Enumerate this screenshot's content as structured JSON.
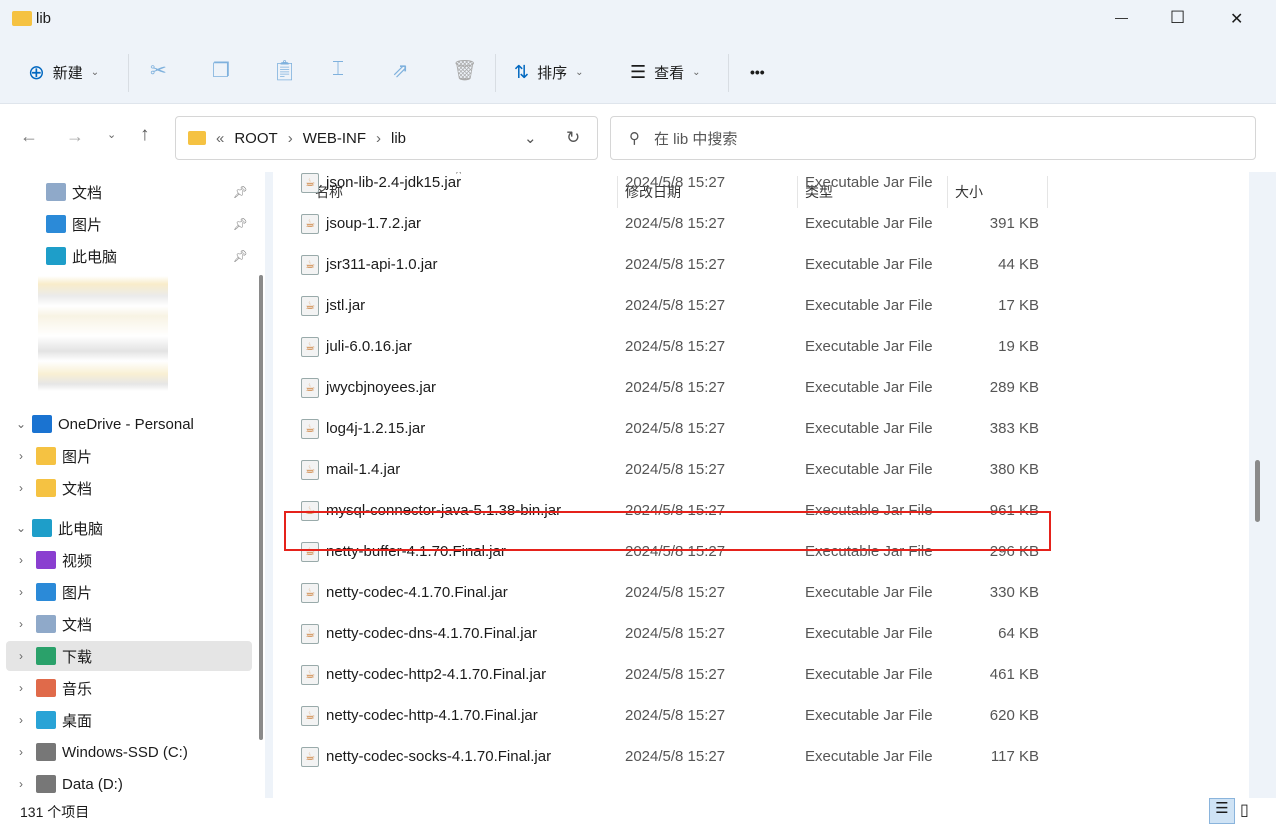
{
  "window": {
    "title": "lib",
    "minimize": "—",
    "maximize": "☐",
    "close": "✕"
  },
  "toolbar": {
    "new_label": "新建",
    "sort_label": "排序",
    "view_label": "查看",
    "more": "•••"
  },
  "address": {
    "crumbs": [
      "«",
      "ROOT",
      "›",
      "WEB-INF",
      "›",
      "lib"
    ],
    "search_placeholder": "在 lib 中搜索"
  },
  "nav": {
    "items": [
      {
        "label": "文档",
        "icon": "documents-icon",
        "pinned": true
      },
      {
        "label": "图片",
        "icon": "pictures-icon",
        "pinned": true
      },
      {
        "label": "此电脑",
        "icon": "computer-icon",
        "pinned": true
      },
      {
        "label": "OneDrive - Personal",
        "icon": "onedrive-icon",
        "expanded": true
      },
      {
        "label": "图片",
        "icon": "folder-icon"
      },
      {
        "label": "文档",
        "icon": "folder-icon"
      },
      {
        "label": "此电脑",
        "icon": "computer-icon",
        "expanded": true
      },
      {
        "label": "视频",
        "icon": "videos-icon"
      },
      {
        "label": "图片",
        "icon": "pictures-icon"
      },
      {
        "label": "文档",
        "icon": "documents-icon"
      },
      {
        "label": "下载",
        "icon": "downloads-icon",
        "selected": true
      },
      {
        "label": "音乐",
        "icon": "music-icon"
      },
      {
        "label": "桌面",
        "icon": "desktop-icon"
      },
      {
        "label": "Windows-SSD (C:)",
        "icon": "drive-icon"
      },
      {
        "label": "Data (D:)",
        "icon": "drive-icon"
      }
    ]
  },
  "columns": {
    "name": "名称",
    "modified": "修改日期",
    "type": "类型",
    "size": "大小"
  },
  "files": [
    {
      "name": "json-lib-2.4-jdk15.jar",
      "date": "2024/5/8 15:27",
      "type": "Executable Jar File",
      "size": ""
    },
    {
      "name": "jsoup-1.7.2.jar",
      "date": "2024/5/8 15:27",
      "type": "Executable Jar File",
      "size": "391 KB"
    },
    {
      "name": "jsr311-api-1.0.jar",
      "date": "2024/5/8 15:27",
      "type": "Executable Jar File",
      "size": "44 KB"
    },
    {
      "name": "jstl.jar",
      "date": "2024/5/8 15:27",
      "type": "Executable Jar File",
      "size": "17 KB"
    },
    {
      "name": "juli-6.0.16.jar",
      "date": "2024/5/8 15:27",
      "type": "Executable Jar File",
      "size": "19 KB"
    },
    {
      "name": "jwycbjnoyees.jar",
      "date": "2024/5/8 15:27",
      "type": "Executable Jar File",
      "size": "289 KB"
    },
    {
      "name": "log4j-1.2.15.jar",
      "date": "2024/5/8 15:27",
      "type": "Executable Jar File",
      "size": "383 KB"
    },
    {
      "name": "mail-1.4.jar",
      "date": "2024/5/8 15:27",
      "type": "Executable Jar File",
      "size": "380 KB"
    },
    {
      "name": "mysql-connector-java-5.1.38-bin.jar",
      "date": "2024/5/8 15:27",
      "type": "Executable Jar File",
      "size": "961 KB",
      "highlighted": true
    },
    {
      "name": "netty-buffer-4.1.70.Final.jar",
      "date": "2024/5/8 15:27",
      "type": "Executable Jar File",
      "size": "296 KB"
    },
    {
      "name": "netty-codec-4.1.70.Final.jar",
      "date": "2024/5/8 15:27",
      "type": "Executable Jar File",
      "size": "330 KB"
    },
    {
      "name": "netty-codec-dns-4.1.70.Final.jar",
      "date": "2024/5/8 15:27",
      "type": "Executable Jar File",
      "size": "64 KB"
    },
    {
      "name": "netty-codec-http2-4.1.70.Final.jar",
      "date": "2024/5/8 15:27",
      "type": "Executable Jar File",
      "size": "461 KB"
    },
    {
      "name": "netty-codec-http-4.1.70.Final.jar",
      "date": "2024/5/8 15:27",
      "type": "Executable Jar File",
      "size": "620 KB"
    },
    {
      "name": "netty-codec-socks-4.1.70.Final.jar",
      "date": "2024/5/8 15:27",
      "type": "Executable Jar File",
      "size": "117 KB"
    }
  ],
  "status": {
    "count": "131 个项目"
  },
  "colors": {
    "highlight": "#e5221b",
    "accent": "#0067c0"
  }
}
